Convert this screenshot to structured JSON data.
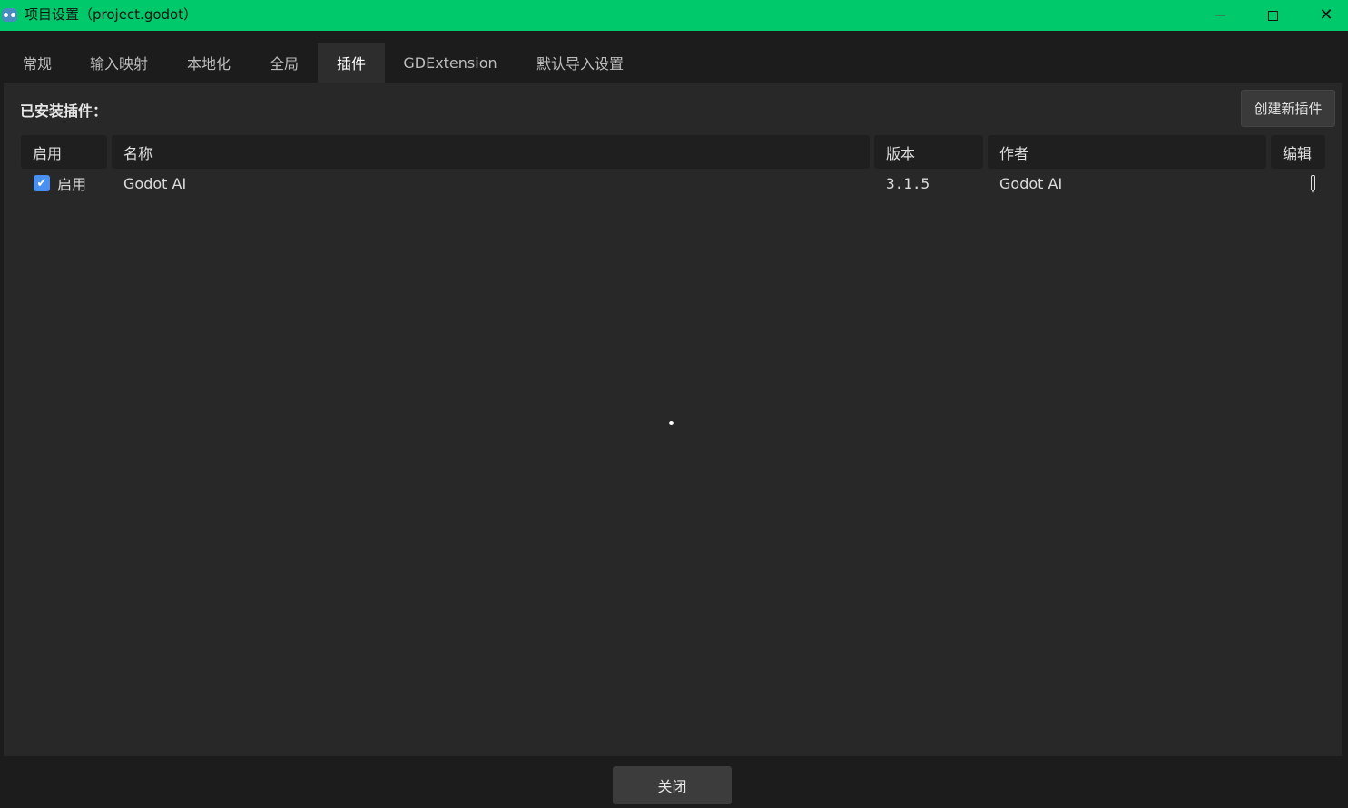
{
  "window": {
    "title": "项目设置（project.godot）",
    "app_icon": "godot-icon",
    "accent_color": "#00c96b"
  },
  "tabs": [
    {
      "label": "常规",
      "active": false
    },
    {
      "label": "输入映射",
      "active": false
    },
    {
      "label": "本地化",
      "active": false
    },
    {
      "label": "全局",
      "active": false
    },
    {
      "label": "插件",
      "active": true
    },
    {
      "label": "GDExtension",
      "active": false
    },
    {
      "label": "默认导入设置",
      "active": false
    }
  ],
  "plugins": {
    "installed_label": "已安装插件：",
    "create_button_label": "创建新插件",
    "columns": [
      "启用",
      "名称",
      "版本",
      "作者",
      "编辑"
    ],
    "rows": [
      {
        "enabled": true,
        "enabled_label": "启用",
        "name": "Godot AI",
        "version": "3.1.5",
        "author": "Godot AI",
        "edit_icon": "pencil-icon"
      }
    ]
  },
  "footer": {
    "close_button_label": "关闭"
  }
}
